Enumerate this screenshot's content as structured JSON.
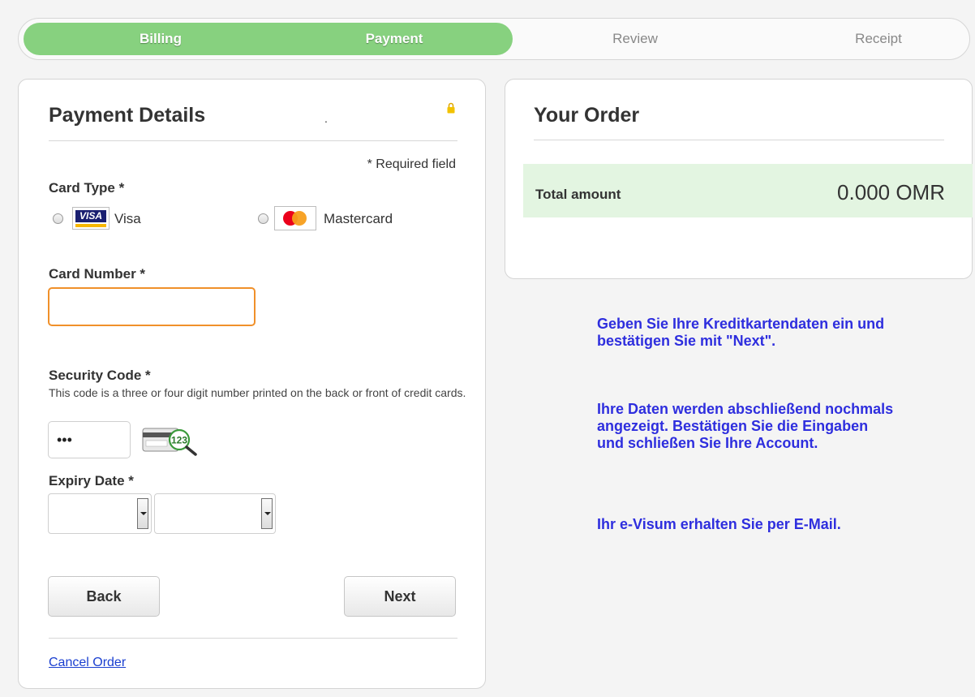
{
  "progress": {
    "steps": [
      {
        "label": "Billing",
        "state": "done"
      },
      {
        "label": "Payment",
        "state": "current"
      },
      {
        "label": "Review",
        "state": "pending"
      },
      {
        "label": "Receipt",
        "state": "pending"
      }
    ]
  },
  "payment": {
    "title": "Payment Details",
    "marker": ".",
    "required_note": "* Required field",
    "card_type_label": "Card Type *",
    "card_options": [
      {
        "label": "Visa",
        "logo_text": "VISA"
      },
      {
        "label": "Mastercard"
      }
    ],
    "card_number_label": "Card Number *",
    "card_number_value": "",
    "security_code_label": "Security Code *",
    "security_code_help": "This code is a three or four digit number printed on the back or front of credit cards.",
    "security_code_value": "•••",
    "cvv_icon_text": "123",
    "expiry_label": "Expiry Date *",
    "expiry_month_value": "",
    "expiry_year_value": "",
    "back_label": "Back",
    "next_label": "Next",
    "cancel_label": "Cancel Order"
  },
  "order": {
    "title": "Your Order",
    "total_label": "Total amount",
    "total_value": "0.000 OMR"
  },
  "info": {
    "p1": "Geben Sie Ihre Kreditkartendaten ein und bestätigen Sie mit \"Next\".",
    "p2": "Ihre Daten werden abschließend nochmals angezeigt. Bestätigen Sie die Eingaben und schließen Sie Ihre Account.",
    "p3": "Ihr e-Visum erhalten Sie per E-Mail."
  },
  "colors": {
    "progress_fill": "#87d17f",
    "input_focus": "#f0902a",
    "link": "#1a3fd0",
    "info_text": "#2e2ede",
    "total_bg": "#e3f5e1"
  }
}
